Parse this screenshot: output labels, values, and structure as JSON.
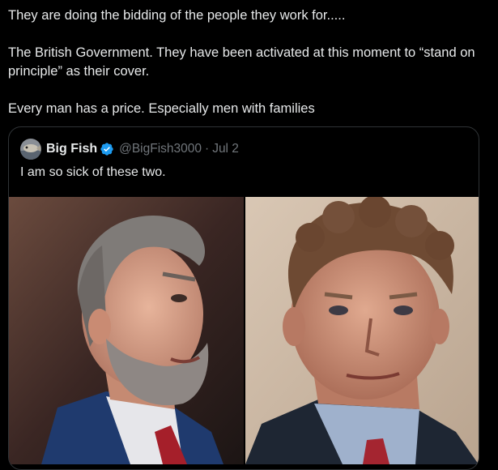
{
  "tweet": {
    "header_partial": "",
    "lines": [
      "They are doing the bidding of the people they work for.....",
      "The British Government.  They have been activated at this moment to “stand on principle” as their cover.",
      "Every man has a price.  Especially men with families"
    ]
  },
  "quote": {
    "name": "Big Fish",
    "handle": "@BigFish3000",
    "separator": "·",
    "date": "Jul 2",
    "text": "I am so sick of these two.",
    "verified_icon": "verified-badge-icon",
    "media_count": 2
  },
  "colors": {
    "background": "#000000",
    "text": "#e7e9ea",
    "muted": "#71767b",
    "border": "#2f3336",
    "verified": "#1d9bf0"
  }
}
